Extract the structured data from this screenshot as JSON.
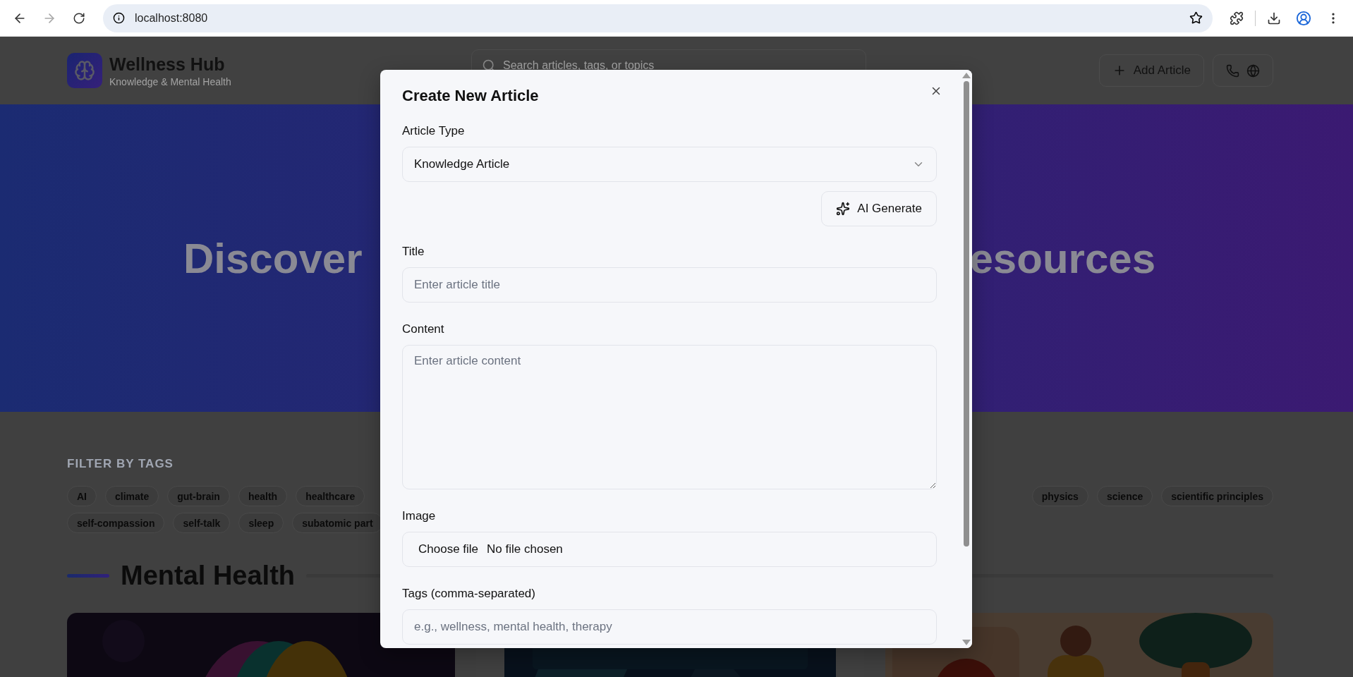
{
  "browser": {
    "url": "localhost:8080",
    "forward_disabled": true
  },
  "header": {
    "title": "Wellness Hub",
    "subtitle": "Knowledge & Mental Health",
    "search": {
      "placeholder": "Search articles, tags, or topics"
    },
    "add_button": "Add Article"
  },
  "hero": {
    "title_left": "Discover",
    "title_right": "esources"
  },
  "filters": {
    "heading": "FILTER BY TAGS",
    "rows": [
      {
        "start": [
          "AI",
          "climate",
          "gut-brain",
          "health",
          "healthcare"
        ],
        "end": [
          "physics",
          "science",
          "scientific principles"
        ]
      },
      {
        "start": [
          "self-compassion",
          "self-talk",
          "sleep",
          "subatomic part"
        ],
        "end": []
      }
    ]
  },
  "section": {
    "title": "Mental Health"
  },
  "modal": {
    "title": "Create New Article",
    "fields": [
      {
        "kind": "select",
        "label": "Article Type",
        "value": "Knowledge Article"
      },
      {
        "kind": "action",
        "button": "AI Generate"
      },
      {
        "kind": "text",
        "label": "Title",
        "placeholder": "Enter article title"
      },
      {
        "kind": "textarea",
        "label": "Content",
        "placeholder": "Enter article content"
      },
      {
        "kind": "file",
        "label": "Image",
        "button": "Choose file",
        "status": "No file chosen"
      },
      {
        "kind": "text",
        "label": "Tags (comma-separated)",
        "placeholder": "e.g., wellness, mental health, therapy"
      }
    ]
  }
}
